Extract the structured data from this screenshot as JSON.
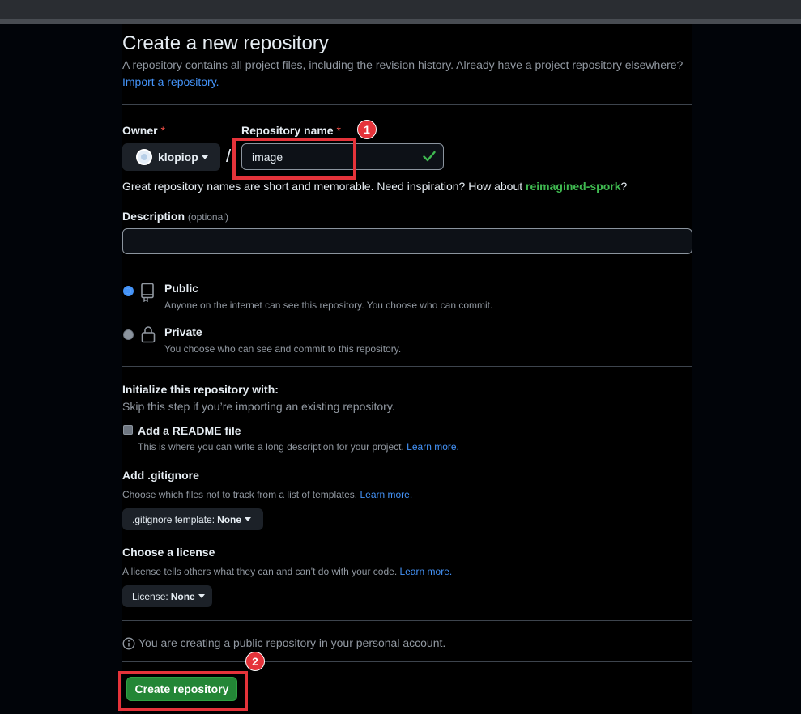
{
  "title": "Create a new repository",
  "intro": {
    "text": "A repository contains all project files, including the revision history. Already have a project repository elsewhere?",
    "import_link": "Import a repository."
  },
  "owner": {
    "label": "Owner",
    "required_mark": "*",
    "value": "klopiop"
  },
  "separator": "/",
  "repo_name": {
    "label": "Repository name",
    "required_mark": "*",
    "value": "image",
    "hint_prefix": "Great repository names are short and memorable. Need inspiration? How about ",
    "suggestion": "reimagined-spork",
    "hint_suffix": "?"
  },
  "description": {
    "label": "Description",
    "optional": "(optional)",
    "value": ""
  },
  "visibility": {
    "selected": "public",
    "public": {
      "title": "Public",
      "desc": "Anyone on the internet can see this repository. You choose who can commit."
    },
    "private": {
      "title": "Private",
      "desc": "You choose who can see and commit to this repository."
    }
  },
  "init": {
    "title": "Initialize this repository with:",
    "subtitle": "Skip this step if you’re importing an existing repository.",
    "readme": {
      "label": "Add a README file",
      "desc": "This is where you can write a long description for your project.",
      "learn_more": "Learn more.",
      "checked": false
    },
    "gitignore": {
      "title": "Add .gitignore",
      "desc": "Choose which files not to track from a list of templates.",
      "learn_more": "Learn more.",
      "button_prefix": ".gitignore template:",
      "button_value": "None"
    },
    "license": {
      "title": "Choose a license",
      "desc": "A license tells others what they can and can't do with your code.",
      "learn_more": "Learn more.",
      "button_prefix": "License:",
      "button_value": "None"
    }
  },
  "notice": "You are creating a public repository in your personal account.",
  "create_button": "Create repository",
  "annotations": {
    "badge_1": "1",
    "badge_2": "2",
    "highlight_color": "#e5333a"
  },
  "colors": {
    "accent_link": "#4493f8",
    "primary_button": "#238636",
    "success_check": "#3fb950",
    "required": "#f85149"
  },
  "icons": {
    "check": "check-icon",
    "public": "repo-icon",
    "private": "lock-icon",
    "info": "info-icon"
  }
}
